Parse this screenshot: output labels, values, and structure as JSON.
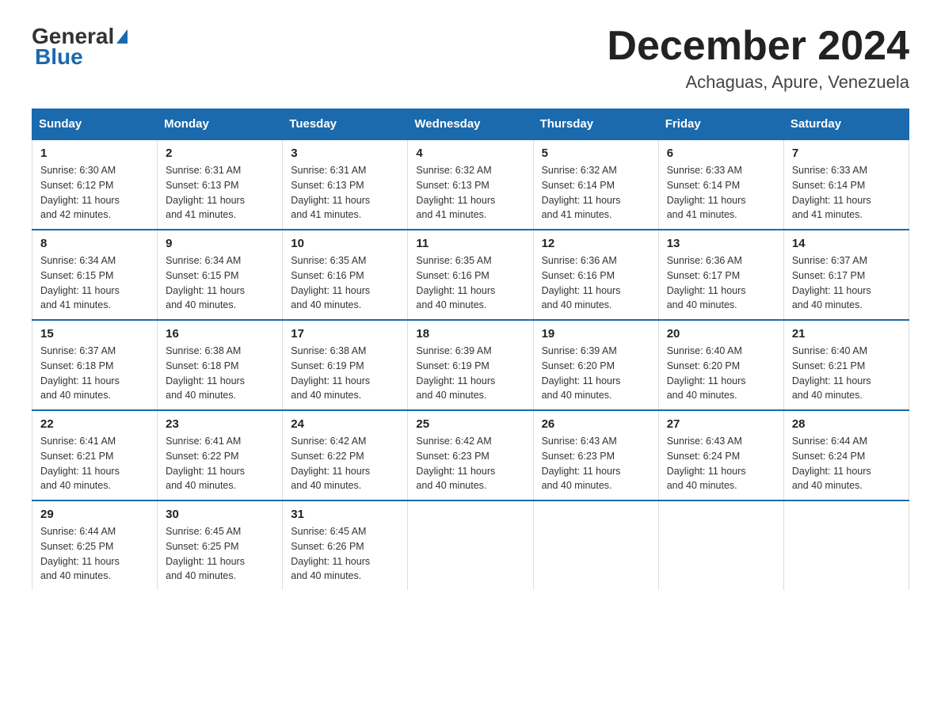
{
  "header": {
    "logo_general": "General",
    "logo_blue": "Blue",
    "month_title": "December 2024",
    "location": "Achaguas, Apure, Venezuela"
  },
  "days_of_week": [
    "Sunday",
    "Monday",
    "Tuesday",
    "Wednesday",
    "Thursday",
    "Friday",
    "Saturday"
  ],
  "weeks": [
    [
      {
        "day": "1",
        "sunrise": "6:30 AM",
        "sunset": "6:12 PM",
        "daylight": "11 hours and 42 minutes."
      },
      {
        "day": "2",
        "sunrise": "6:31 AM",
        "sunset": "6:13 PM",
        "daylight": "11 hours and 41 minutes."
      },
      {
        "day": "3",
        "sunrise": "6:31 AM",
        "sunset": "6:13 PM",
        "daylight": "11 hours and 41 minutes."
      },
      {
        "day": "4",
        "sunrise": "6:32 AM",
        "sunset": "6:13 PM",
        "daylight": "11 hours and 41 minutes."
      },
      {
        "day": "5",
        "sunrise": "6:32 AM",
        "sunset": "6:14 PM",
        "daylight": "11 hours and 41 minutes."
      },
      {
        "day": "6",
        "sunrise": "6:33 AM",
        "sunset": "6:14 PM",
        "daylight": "11 hours and 41 minutes."
      },
      {
        "day": "7",
        "sunrise": "6:33 AM",
        "sunset": "6:14 PM",
        "daylight": "11 hours and 41 minutes."
      }
    ],
    [
      {
        "day": "8",
        "sunrise": "6:34 AM",
        "sunset": "6:15 PM",
        "daylight": "11 hours and 41 minutes."
      },
      {
        "day": "9",
        "sunrise": "6:34 AM",
        "sunset": "6:15 PM",
        "daylight": "11 hours and 40 minutes."
      },
      {
        "day": "10",
        "sunrise": "6:35 AM",
        "sunset": "6:16 PM",
        "daylight": "11 hours and 40 minutes."
      },
      {
        "day": "11",
        "sunrise": "6:35 AM",
        "sunset": "6:16 PM",
        "daylight": "11 hours and 40 minutes."
      },
      {
        "day": "12",
        "sunrise": "6:36 AM",
        "sunset": "6:16 PM",
        "daylight": "11 hours and 40 minutes."
      },
      {
        "day": "13",
        "sunrise": "6:36 AM",
        "sunset": "6:17 PM",
        "daylight": "11 hours and 40 minutes."
      },
      {
        "day": "14",
        "sunrise": "6:37 AM",
        "sunset": "6:17 PM",
        "daylight": "11 hours and 40 minutes."
      }
    ],
    [
      {
        "day": "15",
        "sunrise": "6:37 AM",
        "sunset": "6:18 PM",
        "daylight": "11 hours and 40 minutes."
      },
      {
        "day": "16",
        "sunrise": "6:38 AM",
        "sunset": "6:18 PM",
        "daylight": "11 hours and 40 minutes."
      },
      {
        "day": "17",
        "sunrise": "6:38 AM",
        "sunset": "6:19 PM",
        "daylight": "11 hours and 40 minutes."
      },
      {
        "day": "18",
        "sunrise": "6:39 AM",
        "sunset": "6:19 PM",
        "daylight": "11 hours and 40 minutes."
      },
      {
        "day": "19",
        "sunrise": "6:39 AM",
        "sunset": "6:20 PM",
        "daylight": "11 hours and 40 minutes."
      },
      {
        "day": "20",
        "sunrise": "6:40 AM",
        "sunset": "6:20 PM",
        "daylight": "11 hours and 40 minutes."
      },
      {
        "day": "21",
        "sunrise": "6:40 AM",
        "sunset": "6:21 PM",
        "daylight": "11 hours and 40 minutes."
      }
    ],
    [
      {
        "day": "22",
        "sunrise": "6:41 AM",
        "sunset": "6:21 PM",
        "daylight": "11 hours and 40 minutes."
      },
      {
        "day": "23",
        "sunrise": "6:41 AM",
        "sunset": "6:22 PM",
        "daylight": "11 hours and 40 minutes."
      },
      {
        "day": "24",
        "sunrise": "6:42 AM",
        "sunset": "6:22 PM",
        "daylight": "11 hours and 40 minutes."
      },
      {
        "day": "25",
        "sunrise": "6:42 AM",
        "sunset": "6:23 PM",
        "daylight": "11 hours and 40 minutes."
      },
      {
        "day": "26",
        "sunrise": "6:43 AM",
        "sunset": "6:23 PM",
        "daylight": "11 hours and 40 minutes."
      },
      {
        "day": "27",
        "sunrise": "6:43 AM",
        "sunset": "6:24 PM",
        "daylight": "11 hours and 40 minutes."
      },
      {
        "day": "28",
        "sunrise": "6:44 AM",
        "sunset": "6:24 PM",
        "daylight": "11 hours and 40 minutes."
      }
    ],
    [
      {
        "day": "29",
        "sunrise": "6:44 AM",
        "sunset": "6:25 PM",
        "daylight": "11 hours and 40 minutes."
      },
      {
        "day": "30",
        "sunrise": "6:45 AM",
        "sunset": "6:25 PM",
        "daylight": "11 hours and 40 minutes."
      },
      {
        "day": "31",
        "sunrise": "6:45 AM",
        "sunset": "6:26 PM",
        "daylight": "11 hours and 40 minutes."
      },
      null,
      null,
      null,
      null
    ]
  ],
  "labels": {
    "sunrise": "Sunrise:",
    "sunset": "Sunset:",
    "daylight": "Daylight:"
  },
  "colors": {
    "header_bg": "#1a6aad",
    "header_text": "#ffffff",
    "border_top": "#1a6aad"
  }
}
